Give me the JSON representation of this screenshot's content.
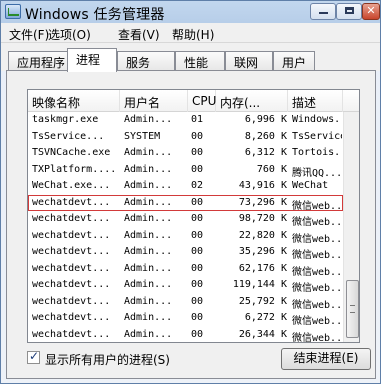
{
  "window": {
    "title": "Windows 任务管理器"
  },
  "menu": [
    "文件(F)",
    "选项(O)",
    "查看(V)",
    "帮助(H)"
  ],
  "tabs": [
    {
      "label": "应用程序",
      "active": false
    },
    {
      "label": "进程",
      "active": true
    },
    {
      "label": "服务",
      "active": false
    },
    {
      "label": "性能",
      "active": false
    },
    {
      "label": "联网",
      "active": false
    },
    {
      "label": "用户",
      "active": false
    }
  ],
  "columns": [
    "映像名称",
    "用户名",
    "CPU",
    "内存(...",
    "描述"
  ],
  "rows": [
    [
      "taskmgr.exe",
      "Admin...",
      "01",
      "6,996 K",
      "Windows..."
    ],
    [
      "TsService...",
      "SYSTEM",
      "00",
      "8,260 K",
      "TsService"
    ],
    [
      "TSVNCache.exe",
      "Admin...",
      "00",
      "6,312 K",
      "Tortois..."
    ],
    [
      "TXPlatform....",
      "Admin...",
      "00",
      "760 K",
      "腾讯QQ..."
    ],
    [
      "WeChat.exe...",
      "Admin...",
      "02",
      "43,916 K",
      "WeChat"
    ],
    [
      "wechatdevt...",
      "Admin...",
      "00",
      "73,296 K",
      "微信web..."
    ],
    [
      "wechatdevt...",
      "Admin...",
      "00",
      "98,720 K",
      "微信web..."
    ],
    [
      "wechatdevt...",
      "Admin...",
      "00",
      "22,820 K",
      "微信web..."
    ],
    [
      "wechatdevt...",
      "Admin...",
      "00",
      "35,296 K",
      "微信web..."
    ],
    [
      "wechatdevt...",
      "Admin...",
      "00",
      "62,176 K",
      "微信web..."
    ],
    [
      "wechatdevt...",
      "Admin...",
      "00",
      "119,144 K",
      "微信web..."
    ],
    [
      "wechatdevt...",
      "Admin...",
      "00",
      "25,792 K",
      "微信web..."
    ],
    [
      "wechatdevt...",
      "Admin...",
      "00",
      "6,272 K",
      "微信web..."
    ],
    [
      "wechatdevt...",
      "Admin...",
      "00",
      "26,344 K",
      "微信web..."
    ],
    [
      "wechatdevt...",
      "Admin...",
      "00",
      "7,576 K",
      "微信web..."
    ]
  ],
  "selected_row": 5,
  "show_all_users": {
    "label": "显示所有用户的进程(S)",
    "checked": true
  },
  "end_process_button": "结束进程(E)"
}
